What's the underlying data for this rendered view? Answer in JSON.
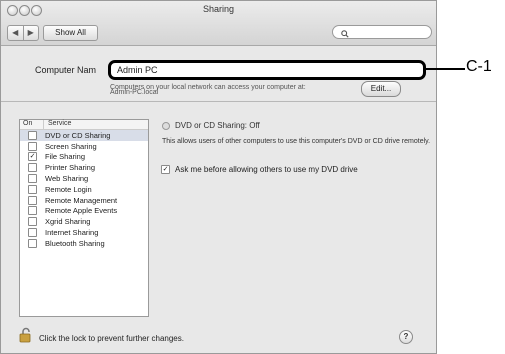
{
  "window": {
    "title": "Sharing"
  },
  "toolbar": {
    "back": "◀",
    "forward": "▶",
    "show_all": "Show All",
    "search_placeholder": ""
  },
  "computer_name": {
    "label": "Computer Nam",
    "value": "Admin PC",
    "description": "Computers on your local network can access your computer at:",
    "local_address": "Admin-PC.local",
    "edit_label": "Edit..."
  },
  "callout": {
    "label": "C-1"
  },
  "services": {
    "col_on": "On",
    "col_service": "Service",
    "items": [
      {
        "label": "DVD or CD Sharing",
        "checked": false,
        "selected": true
      },
      {
        "label": "Screen Sharing",
        "checked": false,
        "selected": false
      },
      {
        "label": "File Sharing",
        "checked": true,
        "selected": false
      },
      {
        "label": "Printer Sharing",
        "checked": false,
        "selected": false
      },
      {
        "label": "Web Sharing",
        "checked": false,
        "selected": false
      },
      {
        "label": "Remote Login",
        "checked": false,
        "selected": false
      },
      {
        "label": "Remote Management",
        "checked": false,
        "selected": false
      },
      {
        "label": "Remote Apple Events",
        "checked": false,
        "selected": false
      },
      {
        "label": "Xgrid Sharing",
        "checked": false,
        "selected": false
      },
      {
        "label": "Internet Sharing",
        "checked": false,
        "selected": false
      },
      {
        "label": "Bluetooth Sharing",
        "checked": false,
        "selected": false
      }
    ]
  },
  "detail": {
    "status": "DVD or CD Sharing: Off",
    "description": "This allows users of other computers to use this computer's DVD or CD drive remotely.",
    "ask_label": "Ask me before allowing others to use my DVD drive",
    "ask_checked": true
  },
  "footer": {
    "lock_text": "Click the lock to prevent further changes.",
    "help": "?"
  }
}
